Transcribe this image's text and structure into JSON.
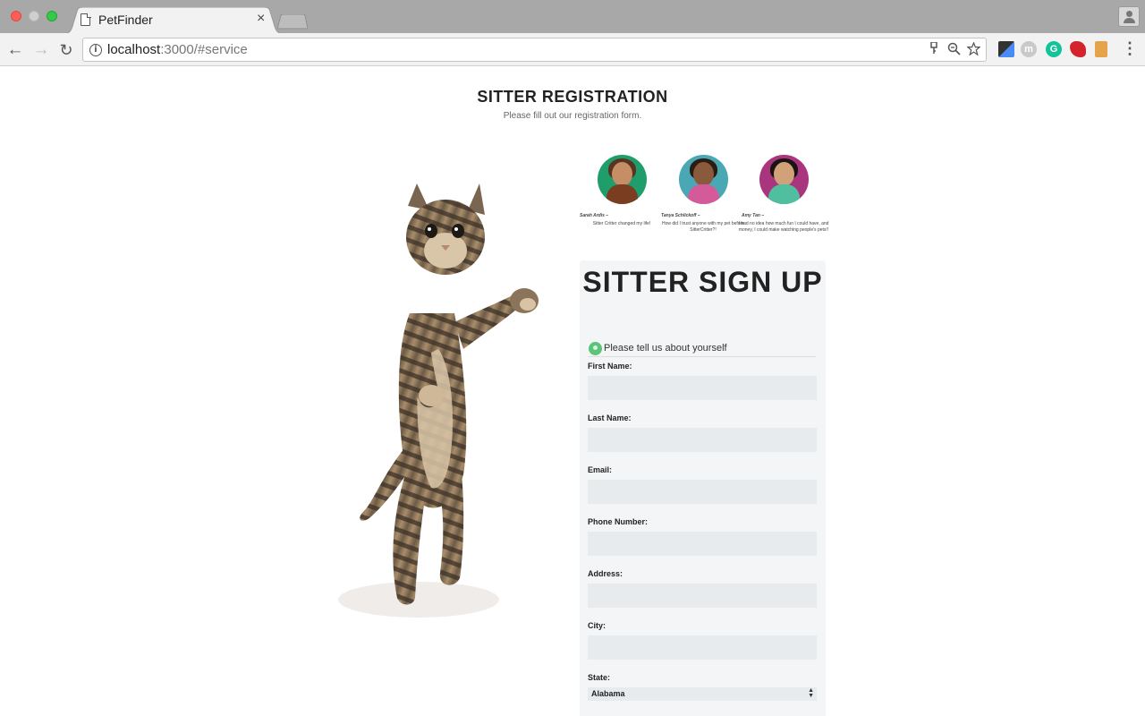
{
  "browser": {
    "tab_title": "PetFinder",
    "tab_close": "×",
    "url_host": "localhost",
    "url_rest": ":3000/#service",
    "nav": {
      "back": "←",
      "forward": "→",
      "reload": "↻"
    },
    "omnibox_icons": [
      "key-icon",
      "zoom-icon",
      "star-icon"
    ],
    "extensions": [
      "eyedropper-extension-icon",
      "m-extension-icon",
      "grammarly-extension-icon",
      "red-extension-icon",
      "ruler-extension-icon"
    ],
    "extension_labels": {
      "m": "m",
      "grammarly": "G"
    },
    "menu": "⋮"
  },
  "page": {
    "title": "SITTER REGISTRATION",
    "subtitle": "Please fill out our registration form."
  },
  "testimonials": [
    {
      "name": "Sarah Ardis –",
      "quote": "Sitter Critter changed my life!",
      "color": "#1f9d6b"
    },
    {
      "name": "Tanya Schlickoff –",
      "quote": "How did I trust anyone with my pet before SitterCritter?!",
      "color": "#4aa8b4"
    },
    {
      "name": "Amy Tan –",
      "quote": "I had no idea how much fun I could have, and money, I could make watching people's pets!!",
      "color": "#a8357e"
    }
  ],
  "form": {
    "title": "SITTER SIGN UP",
    "section": "Please tell us about yourself",
    "fields": {
      "first_name": "First Name:",
      "last_name": "Last Name:",
      "email": "Email:",
      "phone": "Phone Number:",
      "address": "Address:",
      "city": "City:",
      "state": "State:"
    },
    "state_value": "Alabama"
  },
  "colors": {
    "accent_green": "#5bc57a",
    "card_bg": "#f3f5f7",
    "input_bg": "#e8ebed"
  }
}
